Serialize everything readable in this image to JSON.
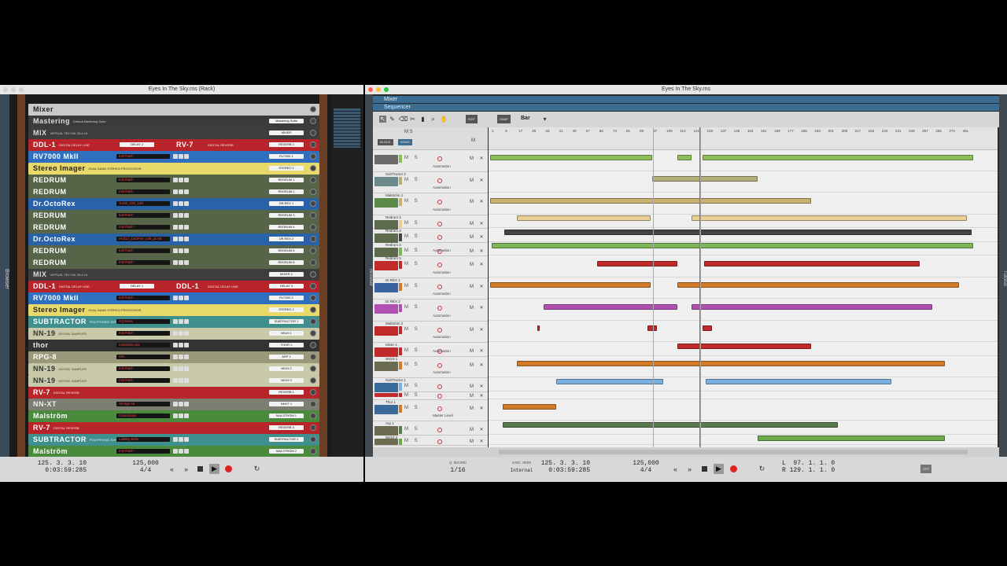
{
  "rack_window": {
    "title": "Eyes In The Sky.rns (Rack)",
    "browser_tab": "Browser",
    "devices": [
      {
        "name": "Mixer",
        "bg": "#c9c9c9",
        "fg": "#222",
        "sub": "",
        "patch": "",
        "tape": ""
      },
      {
        "name": "Mastering",
        "bg": "#3b3b3b",
        "fg": "#ddd",
        "sub": "Default Mastering Suite",
        "patch": "",
        "tape": "Mastering Suite"
      },
      {
        "name": "MIX",
        "bg": "#3d3d3d",
        "fg": "#ddd",
        "sub": "VIRTUAL TEC MX 28-4-14",
        "patch": "",
        "tape": "MIXER"
      },
      {
        "name": "DDL-1",
        "bg": "#b9232a",
        "fg": "#fff",
        "sub": "DIGITAL DELAY LINE",
        "patch": "",
        "tape": "DELAY 2",
        "split": {
          "name": "RV-7",
          "sub": "DIGITAL REVERB",
          "tape": "REVERB 2"
        }
      },
      {
        "name": "RV7000 MkII",
        "bg": "#2f6fc0",
        "fg": "#fff",
        "sub": "",
        "patch": "Init Patch",
        "tape": "RV7000 1"
      },
      {
        "name": "Stereo Imager",
        "bg": "#e9d86a",
        "fg": "#222",
        "sub": "DUAL BAND STEREO PROCESSOR",
        "patch": "",
        "tape": "STEREO 1"
      },
      {
        "name": "REDRUM",
        "bg": "#566448",
        "fg": "#fff",
        "sub": "",
        "patch": "Init Patch",
        "tape": "REDRUM 1"
      },
      {
        "name": "REDRUM",
        "bg": "#566448",
        "fg": "#fff",
        "sub": "",
        "patch": "Init Patch",
        "tape": "REDRUM 2"
      },
      {
        "name": "Dr.OctoRex",
        "bg": "#2a62a8",
        "fg": "#fff",
        "sub": "",
        "patch": "Tomb_02b_120",
        "tape": "DR.REX 1"
      },
      {
        "name": "REDRUM",
        "bg": "#566448",
        "fg": "#fff",
        "sub": "",
        "patch": "Init Patch",
        "tape": "REDRUM 3"
      },
      {
        "name": "REDRUM",
        "bg": "#566448",
        "fg": "#fff",
        "sub": "",
        "patch": "Init Patch",
        "tape": "REDRUM 4"
      },
      {
        "name": "Dr.OctoRex",
        "bg": "#2a62a8",
        "fg": "#fff",
        "sub": "",
        "patch": "Hxd13_DubFire_125_al.AB",
        "tape": "DR.REX 2"
      },
      {
        "name": "REDRUM",
        "bg": "#566448",
        "fg": "#fff",
        "sub": "",
        "patch": "Init Patch",
        "tape": "REDRUM 5"
      },
      {
        "name": "REDRUM",
        "bg": "#566448",
        "fg": "#fff",
        "sub": "",
        "patch": "Init Patch",
        "tape": "REDRUM 6"
      },
      {
        "name": "MIX",
        "bg": "#3d3d3d",
        "fg": "#ddd",
        "sub": "VIRTUAL TEC MX 28-4-14",
        "patch": "",
        "tape": "MIXER 1"
      },
      {
        "name": "DDL-1",
        "bg": "#b9232a",
        "fg": "#fff",
        "sub": "DIGITAL DELAY LINE",
        "patch": "",
        "tape": "DELAY 1",
        "split": {
          "name": "DDL-1",
          "sub": "DIGITAL DELAY LINE",
          "tape": "DELAY 3"
        }
      },
      {
        "name": "RV7000 MkII",
        "bg": "#2f6fc0",
        "fg": "#fff",
        "sub": "",
        "patch": "Init Patch",
        "tape": "RV7000 2"
      },
      {
        "name": "Stereo Imager",
        "bg": "#e9d86a",
        "fg": "#222",
        "sub": "DUAL BAND STEREO PROCESSOR",
        "patch": "",
        "tape": "STEREO 2"
      },
      {
        "name": "SUBTRACTOR",
        "bg": "#3f8f8f",
        "fg": "#fff",
        "sub": "POLYPHONIC SYNTHESIZER",
        "patch": "SQ-Bass",
        "tape": "SUBTRACTOR 1"
      },
      {
        "name": "NN-19",
        "bg": "#c7c9a8",
        "fg": "#333",
        "sub": "DIGITAL SAMPLER",
        "patch": "Init Patch",
        "tape": "NN19 1"
      },
      {
        "name": "thor",
        "bg": "#333333",
        "fg": "#eee",
        "sub": "",
        "patch": "Kaleidoscope",
        "tape": "THOR 1"
      },
      {
        "name": "RPG-8",
        "bg": "#9a9a7a",
        "fg": "#fff",
        "sub": "",
        "patch": "ON",
        "tape": "ARP 1"
      },
      {
        "name": "NN-19",
        "bg": "#c7c9a8",
        "fg": "#333",
        "sub": "DIGITAL SAMPLER",
        "patch": "Init Patch",
        "tape": "NN19 2"
      },
      {
        "name": "NN-19",
        "bg": "#c7c9a8",
        "fg": "#333",
        "sub": "DIGITAL SAMPLER",
        "patch": "Init Patch",
        "tape": "NN19 3"
      },
      {
        "name": "RV-7",
        "bg": "#b9232a",
        "fg": "#fff",
        "sub": "DIGITAL REVERB",
        "patch": "",
        "tape": "REVERB 1"
      },
      {
        "name": "NN-XT",
        "bg": "#7a7f72",
        "fg": "#eee",
        "sub": "",
        "patch": "Strings All",
        "tape": "NNXT 1"
      },
      {
        "name": "Malström",
        "bg": "#4a8a3c",
        "fg": "#fff",
        "sub": "",
        "patch": "Graindrops",
        "tape": "MALSTRÖM 1"
      },
      {
        "name": "RV-7",
        "bg": "#b9232a",
        "fg": "#fff",
        "sub": "DIGITAL REVERB",
        "patch": "",
        "tape": "REVERB 3"
      },
      {
        "name": "SUBTRACTOR",
        "bg": "#3f8f8f",
        "fg": "#fff",
        "sub": "POLYPHONIC SYNTHESIZER",
        "patch": "Lullaby Bells",
        "tape": "SUBTRACTOR 2"
      },
      {
        "name": "Malström",
        "bg": "#4a8a3c",
        "fg": "#fff",
        "sub": "",
        "patch": "Init Patch",
        "tape": "MALSTRÖM 2"
      }
    ],
    "transport": {
      "position": "125.  3.  3.  10",
      "time": "0:03:59:285",
      "tempo": "125,000",
      "signature": "4/4"
    }
  },
  "seq_window": {
    "title": "Eyes In The Sky.rns",
    "mixer_label": "Mixer",
    "sequencer_label": "Sequencer",
    "browser_tab": "Browser",
    "tutorial_tab": "Tutorial",
    "snap_value": "Bar",
    "track_header": {
      "block": "BLOCK",
      "song": "SONG",
      "ms": "M S",
      "m": "M"
    },
    "tracks": [
      {
        "name": "",
        "icon": "#6b6b6b",
        "color": "#8cbf5a",
        "auto": "Automation",
        "h": 26.5
      },
      {
        "name": "SubTractor 2",
        "icon": "#6a8a8a",
        "color": "#b5b07a",
        "auto": "Automation",
        "h": 26.5
      },
      {
        "name": "Malström 1",
        "icon": "#5a8a4a",
        "color": "#c8b070",
        "auto": "Automation",
        "h": 26.5
      },
      {
        "name": "Redrum 2",
        "icon": "#5e6a4e",
        "color": "#e8cf96",
        "auto": "",
        "h": 16.5
      },
      {
        "name": "Redrum 3",
        "icon": "#5e6a4e",
        "color": "#444",
        "auto": "",
        "h": 16.5
      },
      {
        "name": "Redrum 4",
        "icon": "#5e6a4e",
        "color": "#7cb55a",
        "auto": "Automation",
        "h": 16.5
      },
      {
        "name": "Redrum 5",
        "icon": "#c02a2a",
        "color": "#c02a2a",
        "auto": "Automation",
        "h": 26.5
      },
      {
        "name": "Dr.REX 1",
        "icon": "#3a62a0",
        "color": "#d07a2a",
        "auto": "Automation",
        "h": 26.5
      },
      {
        "name": "Dr.REX 2",
        "icon": "#b050b0",
        "color": "#b050b0",
        "auto": "Automation",
        "h": 26.5
      },
      {
        "name": "Malström 2",
        "icon": "#c02a2a",
        "color": "#c02a2a",
        "auto": "Automation",
        "h": 26.5
      },
      {
        "name": "Mixer 1",
        "icon": "#c02a2a",
        "color": "#c02a2a",
        "auto": "Automation",
        "h": 16.5
      },
      {
        "name": "NN19 1",
        "icon": "#6b6b50",
        "color": "#d07a2a",
        "auto": "Automation",
        "h": 26.5
      },
      {
        "name": "SubTractor 1",
        "icon": "#3a6a9a",
        "color": "#7ab0e0",
        "auto": "",
        "h": 16.5
      },
      {
        "name": "Redrum 6",
        "icon": "#c02a2a",
        "color": "#c02a2a",
        "auto": "",
        "h": 9
      },
      {
        "name": "Thor 1",
        "icon": "#3a6a9a",
        "color": "#d07a2a",
        "auto": "Master Level",
        "h": 26.5
      },
      {
        "name": "Arp 1",
        "icon": "#6b6b50",
        "color": "#5a7a50",
        "auto": "",
        "h": 16.5
      },
      {
        "name": "NN19 2",
        "icon": "#6b6b50",
        "color": "#6aaa4a",
        "auto": "",
        "h": 12
      }
    ],
    "ruler_ticks": [
      "1",
      "9",
      "17",
      "25",
      "33",
      "41",
      "49",
      "57",
      "65",
      "73",
      "81",
      "89",
      "97",
      "105",
      "113",
      "121",
      "129",
      "137",
      "145",
      "153",
      "161",
      "169",
      "177",
      "185",
      "193",
      "201",
      "209",
      "217",
      "225",
      "233",
      "241",
      "249",
      "257",
      "265",
      "273",
      "281"
    ],
    "transport": {
      "position": "125.  3.  3.  10",
      "time": "0:03:59:285",
      "tempo": "125,000",
      "signature": "4/4",
      "quantize": "1/16",
      "sync_mode": "Internal",
      "left_loc": "97.  1.  1.  0",
      "right_loc": "129.  1.  1.  0",
      "L": "L",
      "R": "R",
      "off": "OFF",
      "sync_label": "SYNC MODE",
      "quantize_label": "Q RECORD"
    }
  }
}
